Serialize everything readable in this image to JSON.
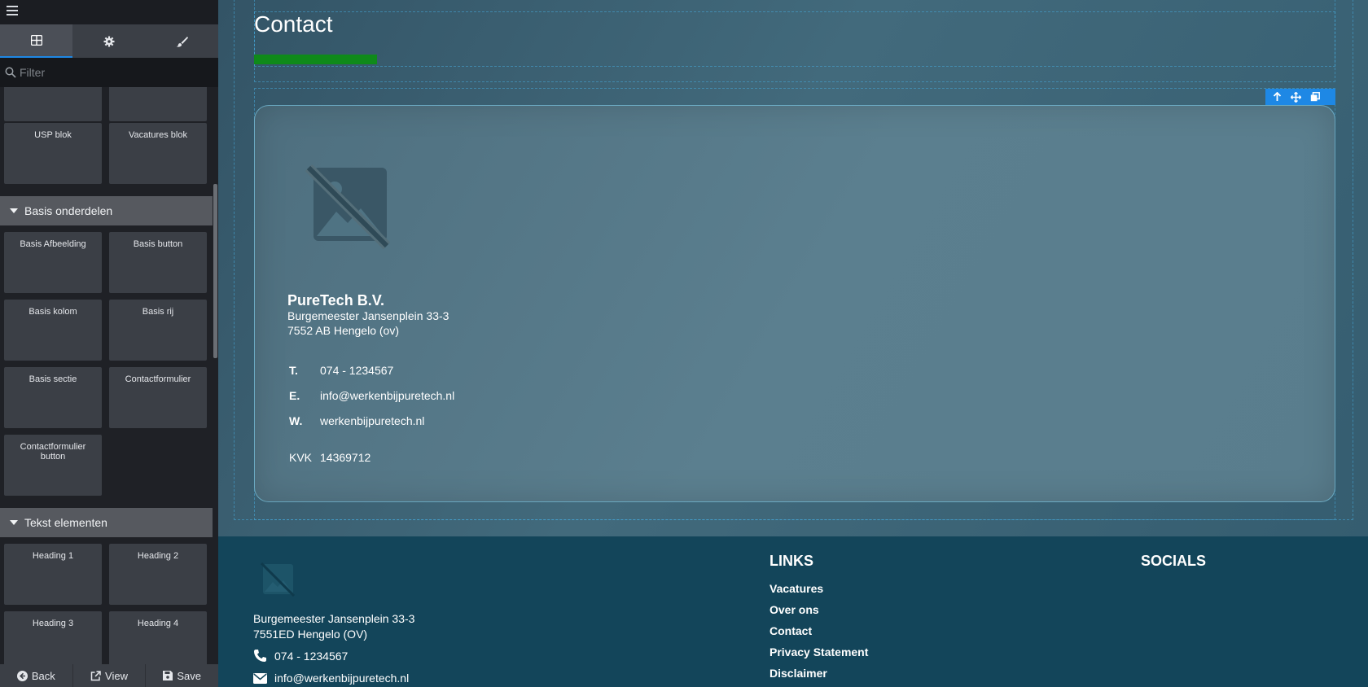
{
  "sidebar": {
    "tabs": [
      {
        "icon": "grid-icon",
        "active": true
      },
      {
        "icon": "gear-icon",
        "active": false
      },
      {
        "icon": "brush-icon",
        "active": false
      }
    ],
    "filter_placeholder": "Filter",
    "partial_blocks": [
      "",
      ""
    ],
    "blocks_top": [
      "USP blok",
      "Vacatures blok"
    ],
    "categories": [
      {
        "label": "Basis onderdelen",
        "blocks": [
          "Basis Afbeelding",
          "Basis button",
          "Basis kolom",
          "Basis rij",
          "Basis sectie",
          "Contactformulier",
          "Contactformulier button"
        ]
      },
      {
        "label": "Tekst elementen",
        "blocks": [
          "Heading 1",
          "Heading 2",
          "Heading 3",
          "Heading 4"
        ]
      }
    ],
    "bottom": {
      "back": "Back",
      "view": "View",
      "save": "Save"
    }
  },
  "canvas": {
    "title": "Contact",
    "accent_color": "#0f8a1a",
    "card": {
      "company": "PureTech B.V.",
      "address_line1": "Burgemeester Jansenplein 33-3",
      "address_line2": "7552 AB Hengelo (ov)",
      "phone_label": "T.",
      "phone": "074 - 1234567",
      "email_label": "E.",
      "email": "info@werkenbijpuretech.nl",
      "web_label": "W.",
      "web": "werkenbijpuretech.nl",
      "kvk_label": "KVK",
      "kvk": "14369712"
    }
  },
  "footer": {
    "address_line1": "Burgemeester Jansenplein 33-3",
    "address_line2": "7551ED Hengelo (OV)",
    "phone": "074 - 1234567",
    "email": "info@werkenbijpuretech.nl",
    "links_heading": "LINKS",
    "links": [
      "Vacatures",
      "Over ons",
      "Contact",
      "Privacy Statement",
      "Disclaimer"
    ],
    "socials_heading": "SOCIALS"
  }
}
